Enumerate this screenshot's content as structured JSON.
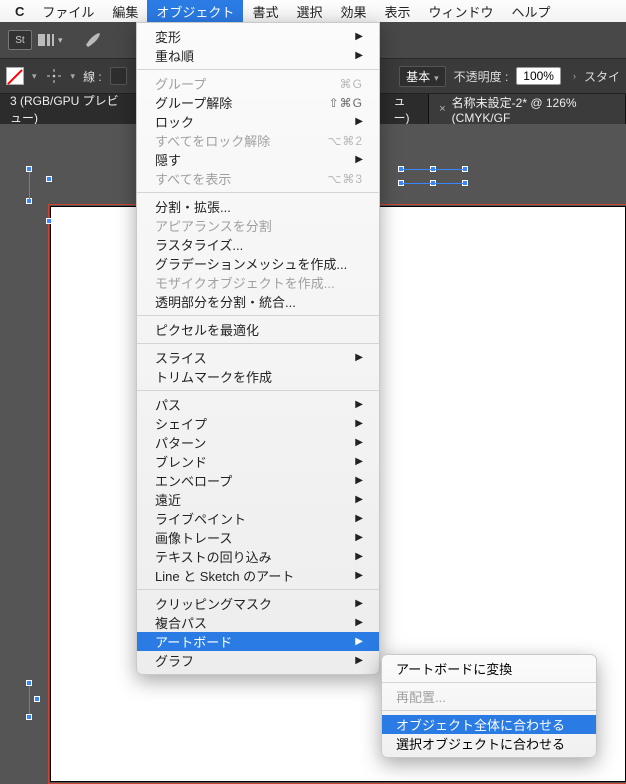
{
  "menubar": {
    "app": "C",
    "items": [
      "ファイル",
      "編集",
      "オブジェクト",
      "書式",
      "選択",
      "効果",
      "表示",
      "ウィンドウ",
      "ヘルプ"
    ],
    "active_index": 2
  },
  "toolbar": {
    "st_label": "St"
  },
  "optbar": {
    "stroke_label": "線 :",
    "style_label": "基本",
    "opacity_label": "不透明度 :",
    "opacity_value": "100%",
    "style_link": "スタイ"
  },
  "tabs": {
    "left_fragment": "3 (RGB/GPU プレビュー)",
    "mid_fragment": "ュー)",
    "right": "名称未設定-2* @ 126% (CMYK/GF"
  },
  "menu": [
    {
      "t": "item",
      "label": "変形",
      "arrow": true
    },
    {
      "t": "item",
      "label": "重ね順",
      "arrow": true
    },
    {
      "t": "sep"
    },
    {
      "t": "item",
      "label": "グループ",
      "sc": "⌘G",
      "disabled": true
    },
    {
      "t": "item",
      "label": "グループ解除",
      "sc": "⇧⌘G"
    },
    {
      "t": "item",
      "label": "ロック",
      "arrow": true
    },
    {
      "t": "item",
      "label": "すべてをロック解除",
      "sc": "⌥⌘2",
      "disabled": true
    },
    {
      "t": "item",
      "label": "隠す",
      "arrow": true
    },
    {
      "t": "item",
      "label": "すべてを表示",
      "sc": "⌥⌘3",
      "disabled": true
    },
    {
      "t": "sep"
    },
    {
      "t": "item",
      "label": "分割・拡張..."
    },
    {
      "t": "item",
      "label": "アピアランスを分割",
      "disabled": true
    },
    {
      "t": "item",
      "label": "ラスタライズ..."
    },
    {
      "t": "item",
      "label": "グラデーションメッシュを作成..."
    },
    {
      "t": "item",
      "label": "モザイクオブジェクトを作成...",
      "disabled": true
    },
    {
      "t": "item",
      "label": "透明部分を分割・統合..."
    },
    {
      "t": "sep"
    },
    {
      "t": "item",
      "label": "ピクセルを最適化"
    },
    {
      "t": "sep"
    },
    {
      "t": "item",
      "label": "スライス",
      "arrow": true
    },
    {
      "t": "item",
      "label": "トリムマークを作成"
    },
    {
      "t": "sep"
    },
    {
      "t": "item",
      "label": "パス",
      "arrow": true
    },
    {
      "t": "item",
      "label": "シェイプ",
      "arrow": true
    },
    {
      "t": "item",
      "label": "パターン",
      "arrow": true
    },
    {
      "t": "item",
      "label": "ブレンド",
      "arrow": true
    },
    {
      "t": "item",
      "label": "エンベロープ",
      "arrow": true
    },
    {
      "t": "item",
      "label": "遠近",
      "arrow": true
    },
    {
      "t": "item",
      "label": "ライブペイント",
      "arrow": true
    },
    {
      "t": "item",
      "label": "画像トレース",
      "arrow": true
    },
    {
      "t": "item",
      "label": "テキストの回り込み",
      "arrow": true
    },
    {
      "t": "item",
      "label": "Line と Sketch のアート",
      "arrow": true
    },
    {
      "t": "sep"
    },
    {
      "t": "item",
      "label": "クリッピングマスク",
      "arrow": true
    },
    {
      "t": "item",
      "label": "複合パス",
      "arrow": true
    },
    {
      "t": "item",
      "label": "アートボード",
      "arrow": true,
      "hover": true
    },
    {
      "t": "item",
      "label": "グラフ",
      "arrow": true
    }
  ],
  "submenu": [
    {
      "label": "アートボードに変換"
    },
    {
      "t": "sep"
    },
    {
      "label": "再配置...",
      "disabled": true
    },
    {
      "t": "sep"
    },
    {
      "label": "オブジェクト全体に合わせる",
      "hover": true
    },
    {
      "label": "選択オブジェクトに合わせる"
    }
  ]
}
